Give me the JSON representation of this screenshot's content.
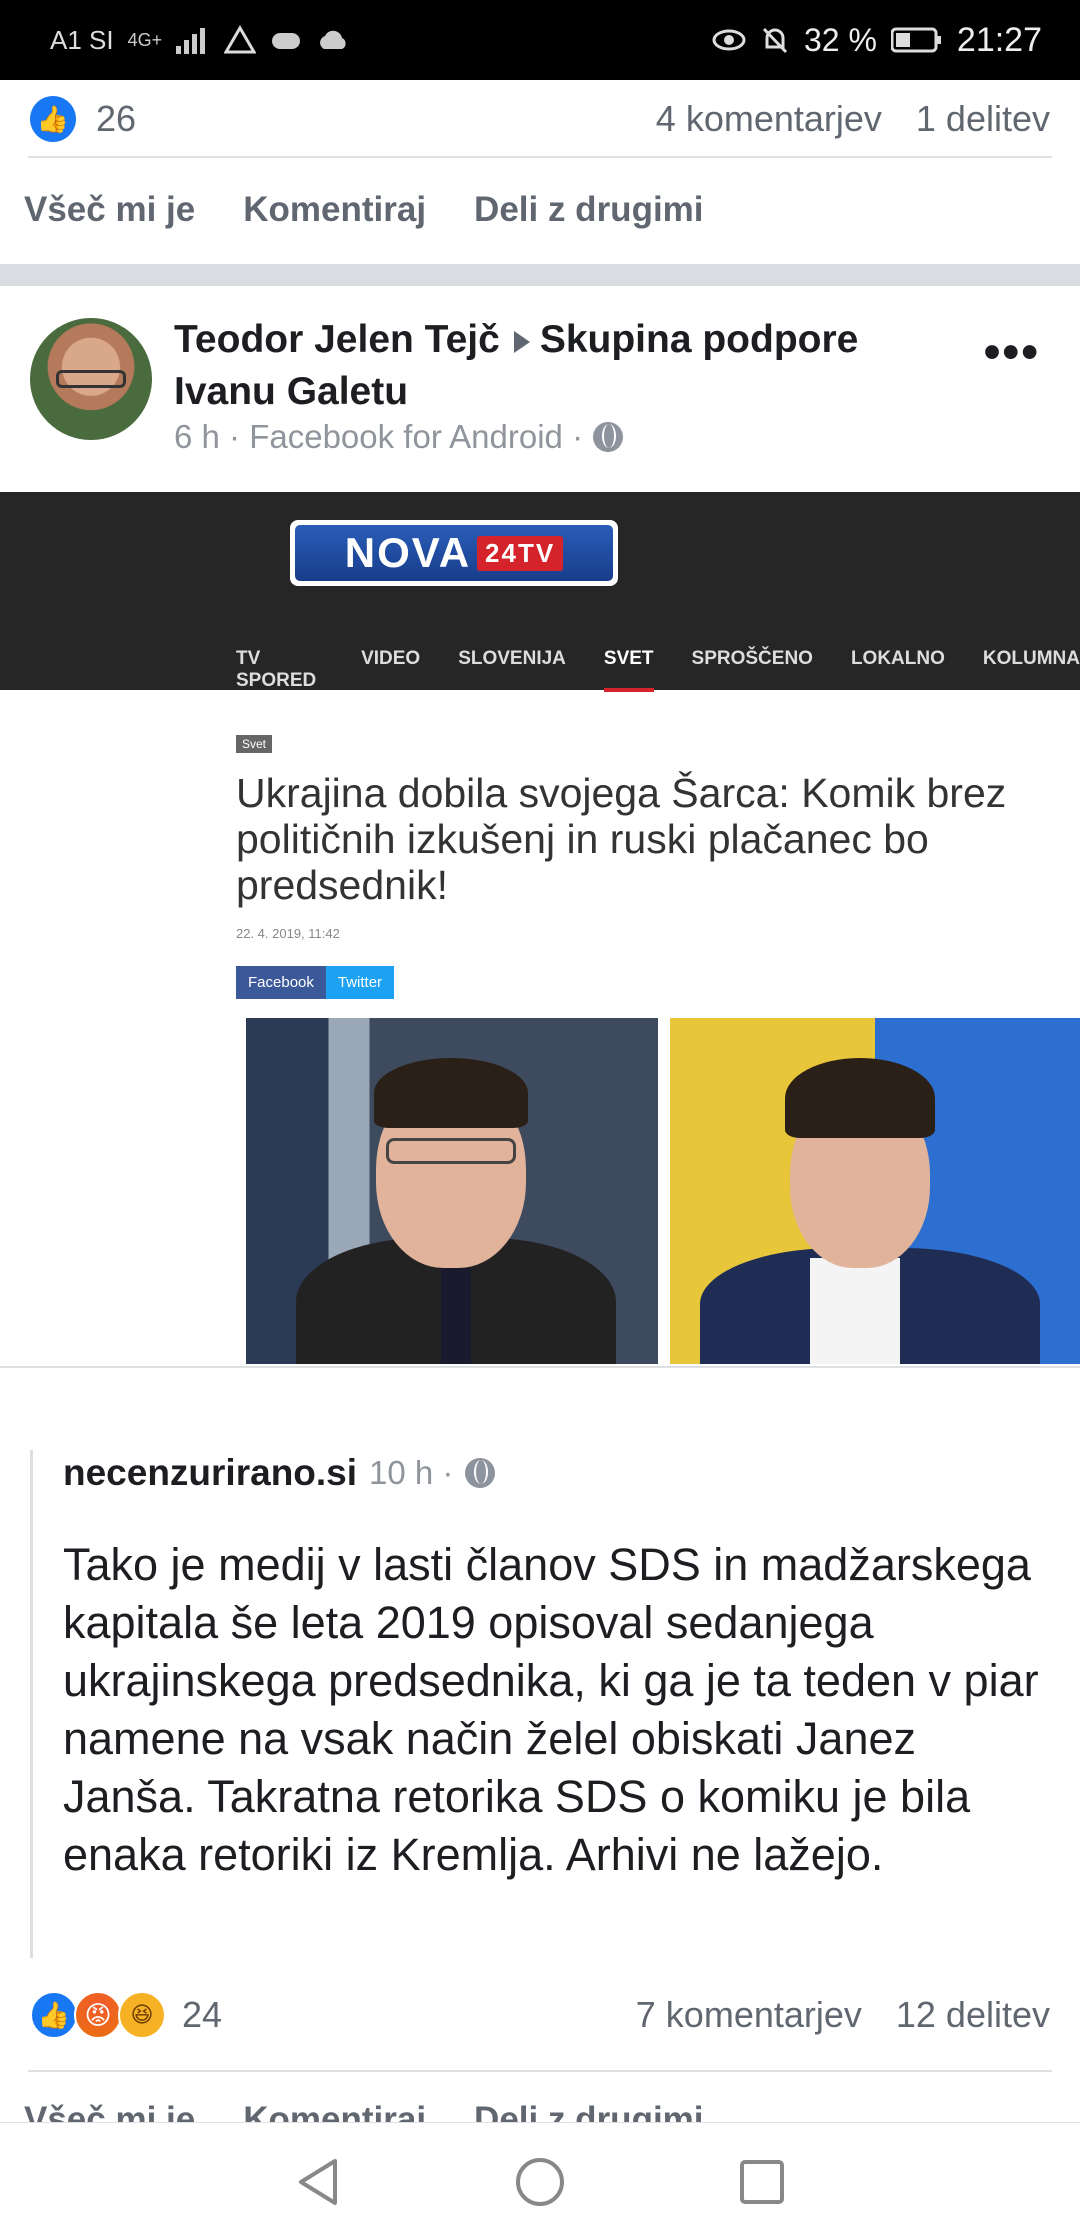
{
  "status_bar": {
    "carrier": "A1 SI",
    "network": "4G+",
    "battery": "32 %",
    "time": "21:27"
  },
  "previous_post": {
    "reaction_count": "26",
    "comments": "4 komentarjev",
    "shares": "1 delitev",
    "actions": {
      "like": "Všeč mi je",
      "comment": "Komentiraj",
      "share": "Deli z drugimi"
    }
  },
  "post": {
    "author": "Teodor Jelen Tejč",
    "group": "Skupina podpore Ivanu Galetu",
    "meta": "6 h · Facebook for Android ·",
    "more": "•••"
  },
  "news_image": {
    "logo_main": "NOVA",
    "logo_suffix": "24TV",
    "nav": [
      "TV SPORED",
      "VIDEO",
      "SLOVENIJA",
      "SVET",
      "SPROŠČENO",
      "LOKALNO",
      "KOLUMNA"
    ],
    "active_nav": "SVET",
    "badge": "Svet",
    "headline": "Ukrajina dobila svojega Šarca: Komik brez političnih izkušenj in ruski plačanec bo predsednik!",
    "date": "22. 4. 2019, 11:42",
    "share_facebook": "Facebook",
    "share_twitter": "Twitter"
  },
  "quoted_post": {
    "source": "necenzurirano.si",
    "time": "10 h ·",
    "text": "Tako je medij v lasti članov SDS in madžarskega kapitala še leta 2019 opisoval sedanjega ukrajinskega predsednika, ki ga je ta teden v piar namene na vsak način želel obiskati Janez Janša. Takratna retorika SDS o komiku je bila enaka retoriki iz Kremlja. Arhivi ne lažejo."
  },
  "post_footer": {
    "reaction_count": "24",
    "reactions": [
      "like-icon",
      "angry-icon",
      "haha-icon"
    ],
    "comments": "7 komentarjev",
    "shares": "12 delitev",
    "actions": {
      "like": "Všeč mi je",
      "comment": "Komentiraj",
      "share": "Deli z drugimi"
    }
  },
  "colors": {
    "facebook_blue": "#1877f2",
    "secondary_text": "#606770",
    "nova_red": "#d4232b"
  }
}
